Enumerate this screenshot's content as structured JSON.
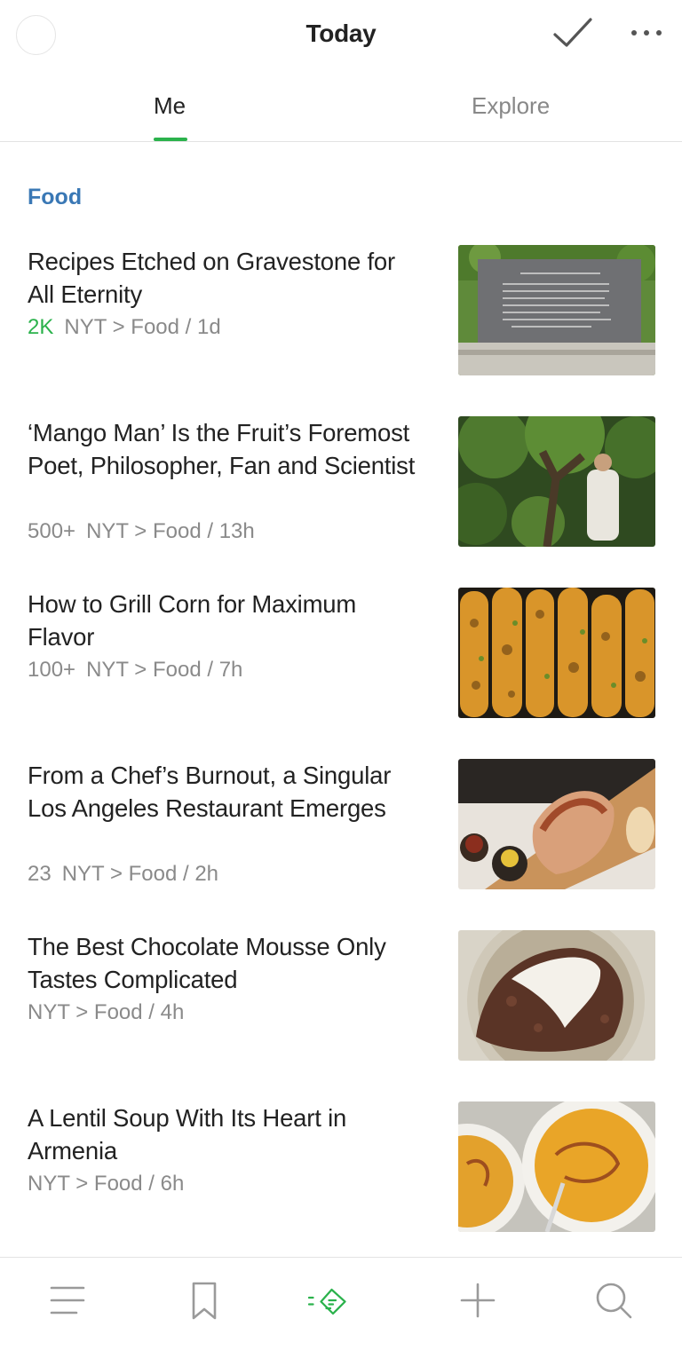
{
  "header": {
    "title": "Today"
  },
  "tabs": [
    {
      "label": "Me",
      "active": true
    },
    {
      "label": "Explore",
      "active": false
    }
  ],
  "section": {
    "title": "Food"
  },
  "articles": [
    {
      "title": "Recipes Etched on Gravestone for All Eternity",
      "engagement": "2K",
      "engagement_hot": true,
      "source": "NYT > Food / 1d"
    },
    {
      "title": "‘Mango Man’ Is the Fruit’s Foremost Poet, Philosopher, Fan and Scientist",
      "engagement": "500+",
      "engagement_hot": false,
      "source": "NYT > Food / 13h"
    },
    {
      "title": "How to Grill Corn for Maximum Flavor",
      "engagement": "100+",
      "engagement_hot": false,
      "source": "NYT > Food / 7h"
    },
    {
      "title": "From a Chef’s Burnout, a Singular Los Angeles Restaurant Emerges",
      "engagement": "23",
      "engagement_hot": false,
      "source": "NYT > Food / 2h"
    },
    {
      "title": "The Best Chocolate Mousse Only Tastes Complicated",
      "engagement": "",
      "engagement_hot": false,
      "source": "NYT > Food / 4h"
    },
    {
      "title": "A Lentil Soup With Its Heart in Armenia",
      "engagement": "",
      "engagement_hot": false,
      "source": "NYT > Food / 6h"
    }
  ],
  "icons": {
    "header": [
      "avatar",
      "check-icon",
      "more-icon"
    ],
    "bottom_nav": [
      "menu-icon",
      "bookmark-icon",
      "feedly-today-icon",
      "add-icon",
      "search-icon"
    ]
  },
  "colors": {
    "accent_green": "#2bb24c",
    "section_blue": "#3a78b5",
    "meta_gray": "#8a8a8a"
  }
}
